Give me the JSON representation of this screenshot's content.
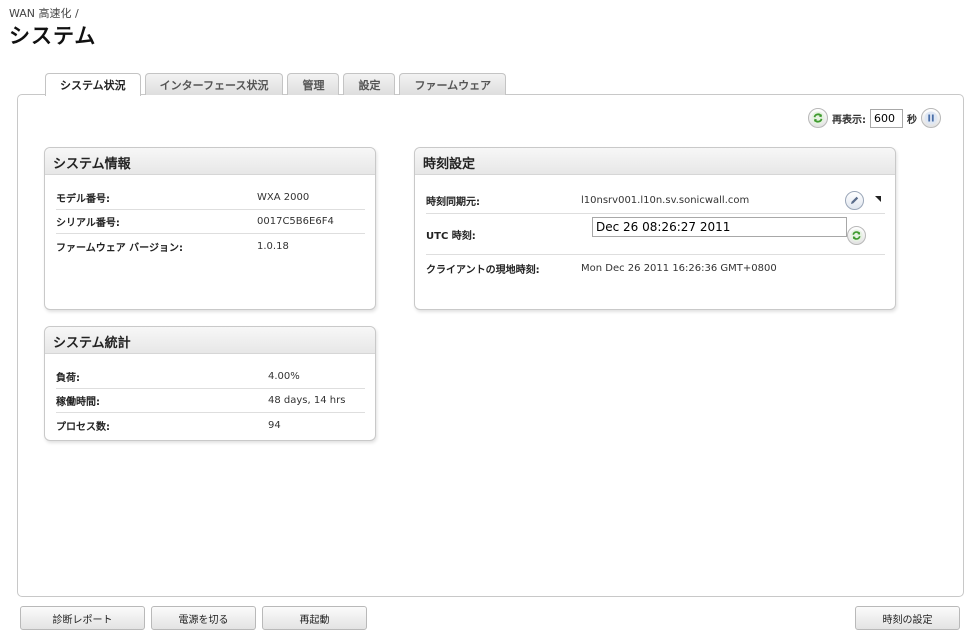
{
  "breadcrumb": "WAN 高速化 /",
  "page_title": "システム",
  "tabs": [
    {
      "label": "システム状況",
      "active": true
    },
    {
      "label": "インターフェース状況",
      "active": false
    },
    {
      "label": "管理",
      "active": false
    },
    {
      "label": "設定",
      "active": false
    },
    {
      "label": "ファームウェア",
      "active": false
    }
  ],
  "refresh": {
    "label": "再表示:",
    "value": "600",
    "unit": "秒"
  },
  "system_info": {
    "title": "システム情報",
    "rows": [
      {
        "label": "モデル番号:",
        "value": "WXA 2000"
      },
      {
        "label": "シリアル番号:",
        "value": "0017C5B6E6F4"
      },
      {
        "label": "ファームウェア バージョン:",
        "value": "1.0.18"
      }
    ]
  },
  "system_stats": {
    "title": "システム統計",
    "rows": [
      {
        "label": "負荷:",
        "value": "4.00%"
      },
      {
        "label": "稼働時間:",
        "value": "48 days, 14 hrs"
      },
      {
        "label": "プロセス数:",
        "value": "94"
      }
    ]
  },
  "time_settings": {
    "title": "時刻設定",
    "sync_source_label": "時刻同期元:",
    "sync_source_value": "l10nsrv001.l10n.sv.sonicwall.com",
    "utc_label": "UTC 時刻:",
    "utc_value": "Dec 26 08:26:27 2011",
    "client_label": "クライアントの現地時刻:",
    "client_value": "Mon Dec 26 2011 16:26:36 GMT+0800"
  },
  "footer_buttons": {
    "diagnostic_report": "診断レポート",
    "power_off": "電源を切る",
    "restart": "再起動",
    "time_settings": "時刻の設定"
  },
  "colors": {
    "accent_green": "#3f9a2f",
    "pause_blue": "#4a6fa8"
  }
}
